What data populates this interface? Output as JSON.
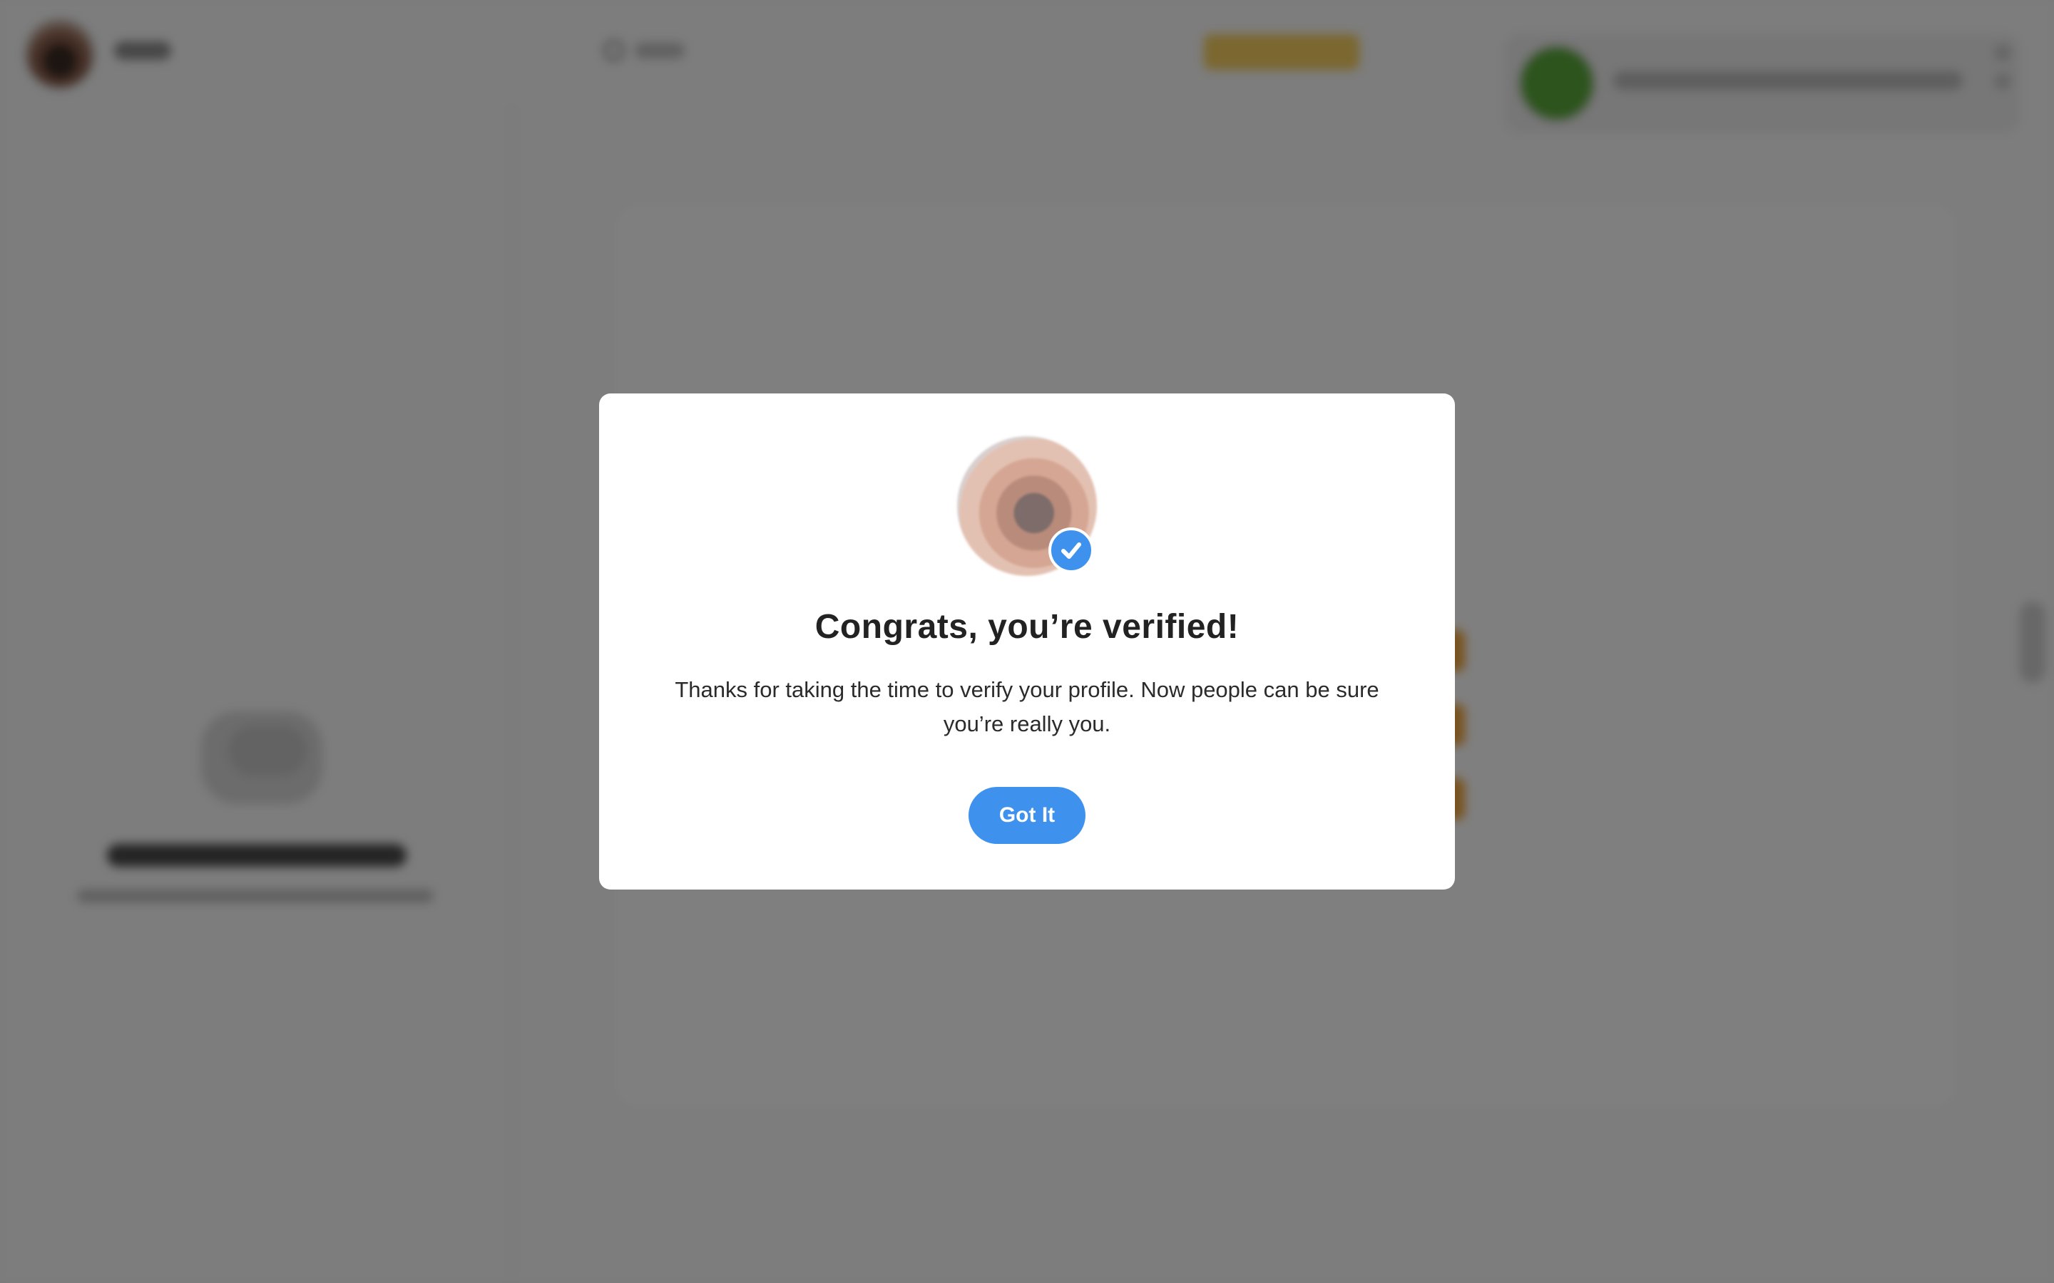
{
  "modal": {
    "title": "Congrats, you’re verified!",
    "body": "Thanks for taking the time to verify your profile. Now people can be sure you’re really you.",
    "button_label": "Got It",
    "badge_icon": "check-icon"
  },
  "colors": {
    "accent": "#3e92ee",
    "overlay": "rgba(0,0,0,0.5)",
    "title": "#222222"
  }
}
